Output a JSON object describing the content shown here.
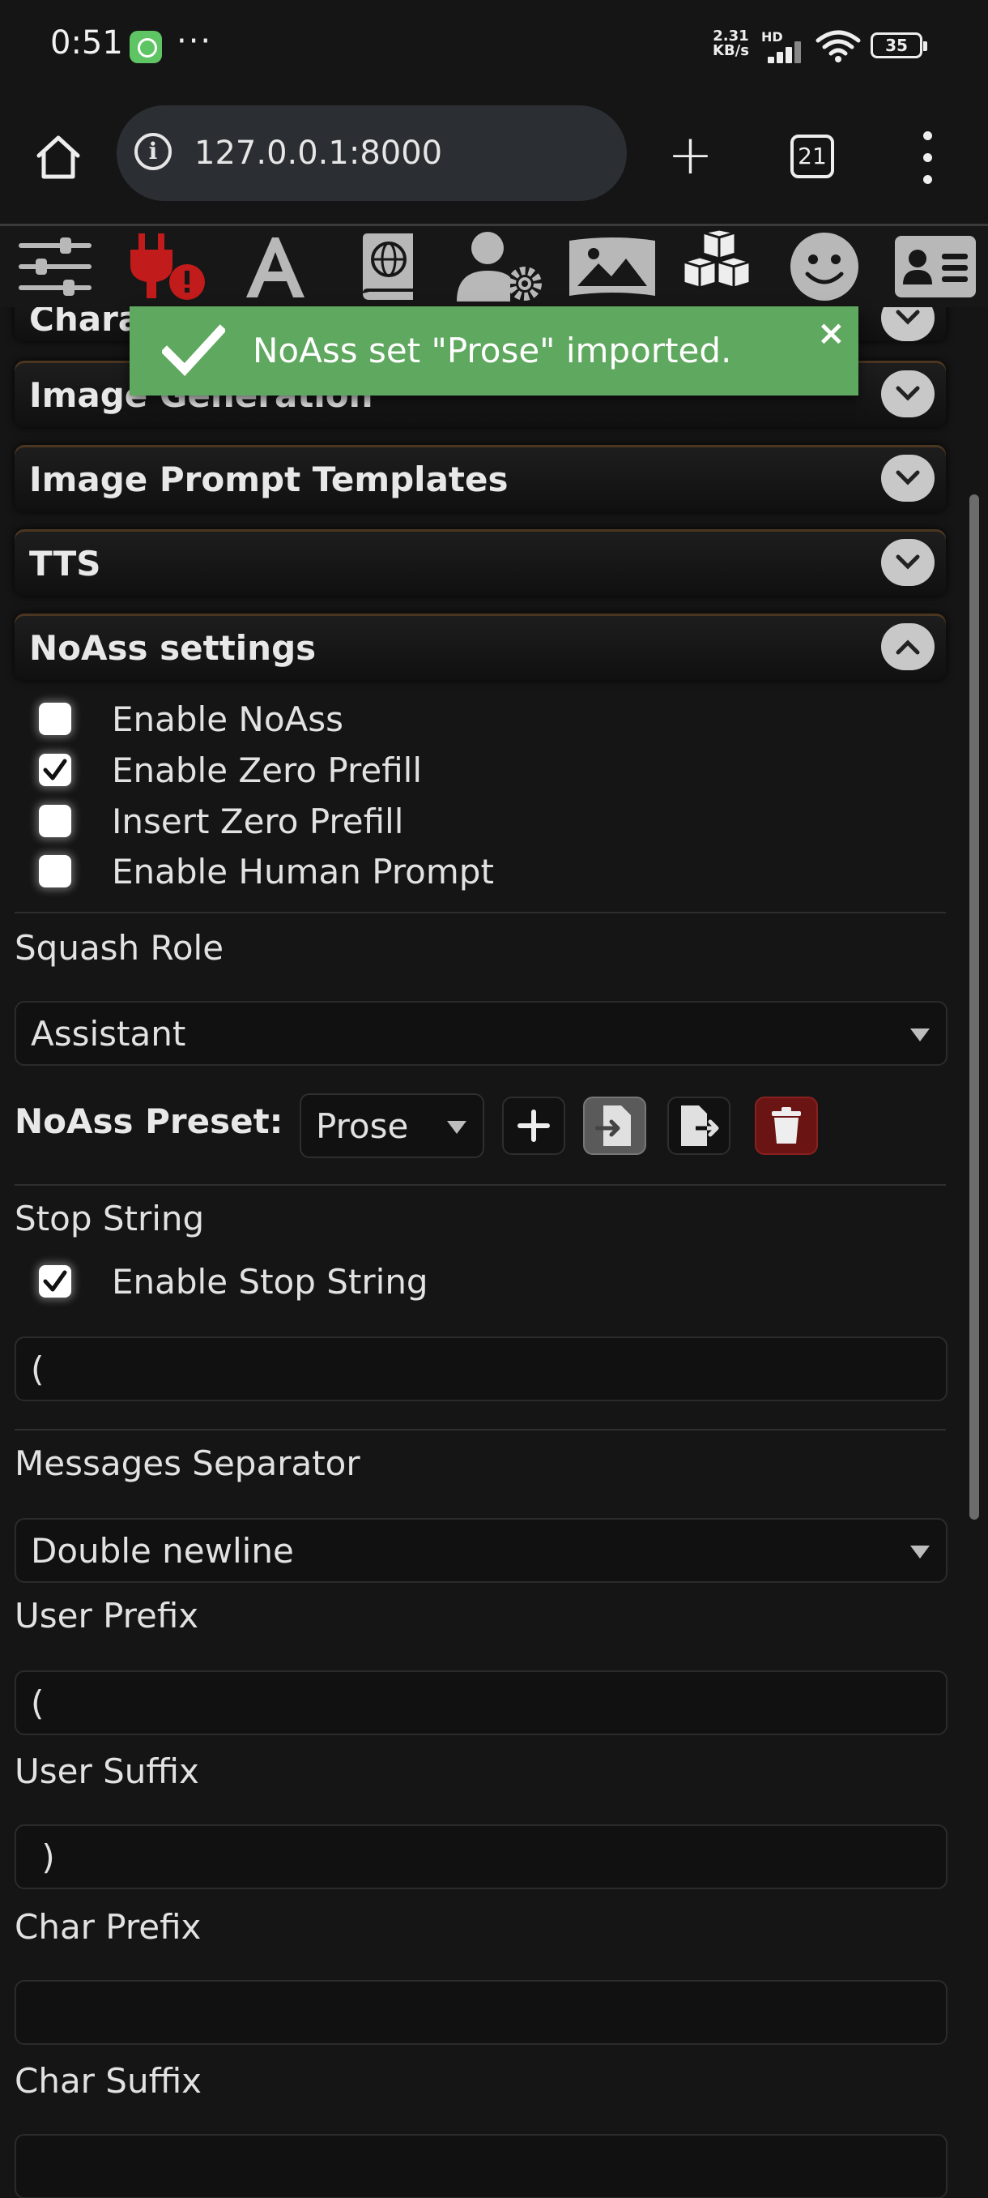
{
  "status_bar": {
    "time": "0:51",
    "overflow": "···",
    "net_speed_top": "2.31",
    "net_speed_bottom": "KB/s",
    "hd": "HD",
    "battery": "35"
  },
  "browser": {
    "url": "127.0.0.1:8000",
    "tab_count": "21"
  },
  "toolbar_icons": [
    "sliders-icon",
    "plug-warning-icon",
    "font-a-icon",
    "world-book-icon",
    "user-gear-icon",
    "image-icon",
    "cubes-icon",
    "smiley-icon",
    "id-card-icon"
  ],
  "toast": {
    "message": "NoAss set \"Prose\" imported.",
    "close": "×",
    "color": "#5fa85f"
  },
  "drawers": {
    "partial_top": "Chara",
    "image_generation": "Image Generation",
    "image_prompt_templates": "Image Prompt Templates",
    "tts": "TTS",
    "noass_settings": "NoAss settings"
  },
  "noass": {
    "checkboxes": [
      {
        "label": "Enable NoAss",
        "checked": false
      },
      {
        "label": "Enable Zero Prefill",
        "checked": true
      },
      {
        "label": "Insert Zero Prefill",
        "checked": false
      },
      {
        "label": "Enable Human Prompt",
        "checked": false
      }
    ],
    "squash_role_label": "Squash Role",
    "squash_role_value": "Assistant",
    "preset_label": "NoAss Preset:",
    "preset_value": "Prose",
    "stop_string_label": "Stop String",
    "enable_stop_string": {
      "label": "Enable Stop String",
      "checked": true
    },
    "stop_string_value": "(",
    "messages_separator_label": "Messages Separator",
    "messages_separator_value": "Double newline",
    "user_prefix_label": "User Prefix",
    "user_prefix_value": "(",
    "user_suffix_label": "User Suffix",
    "user_suffix_value": " )",
    "char_prefix_label": "Char Prefix",
    "char_prefix_value": "",
    "char_suffix_label": "Char Suffix",
    "char_suffix_value": ""
  },
  "colors": {
    "accent_warning": "#c11b1b",
    "delete_button": "#6b1414"
  }
}
